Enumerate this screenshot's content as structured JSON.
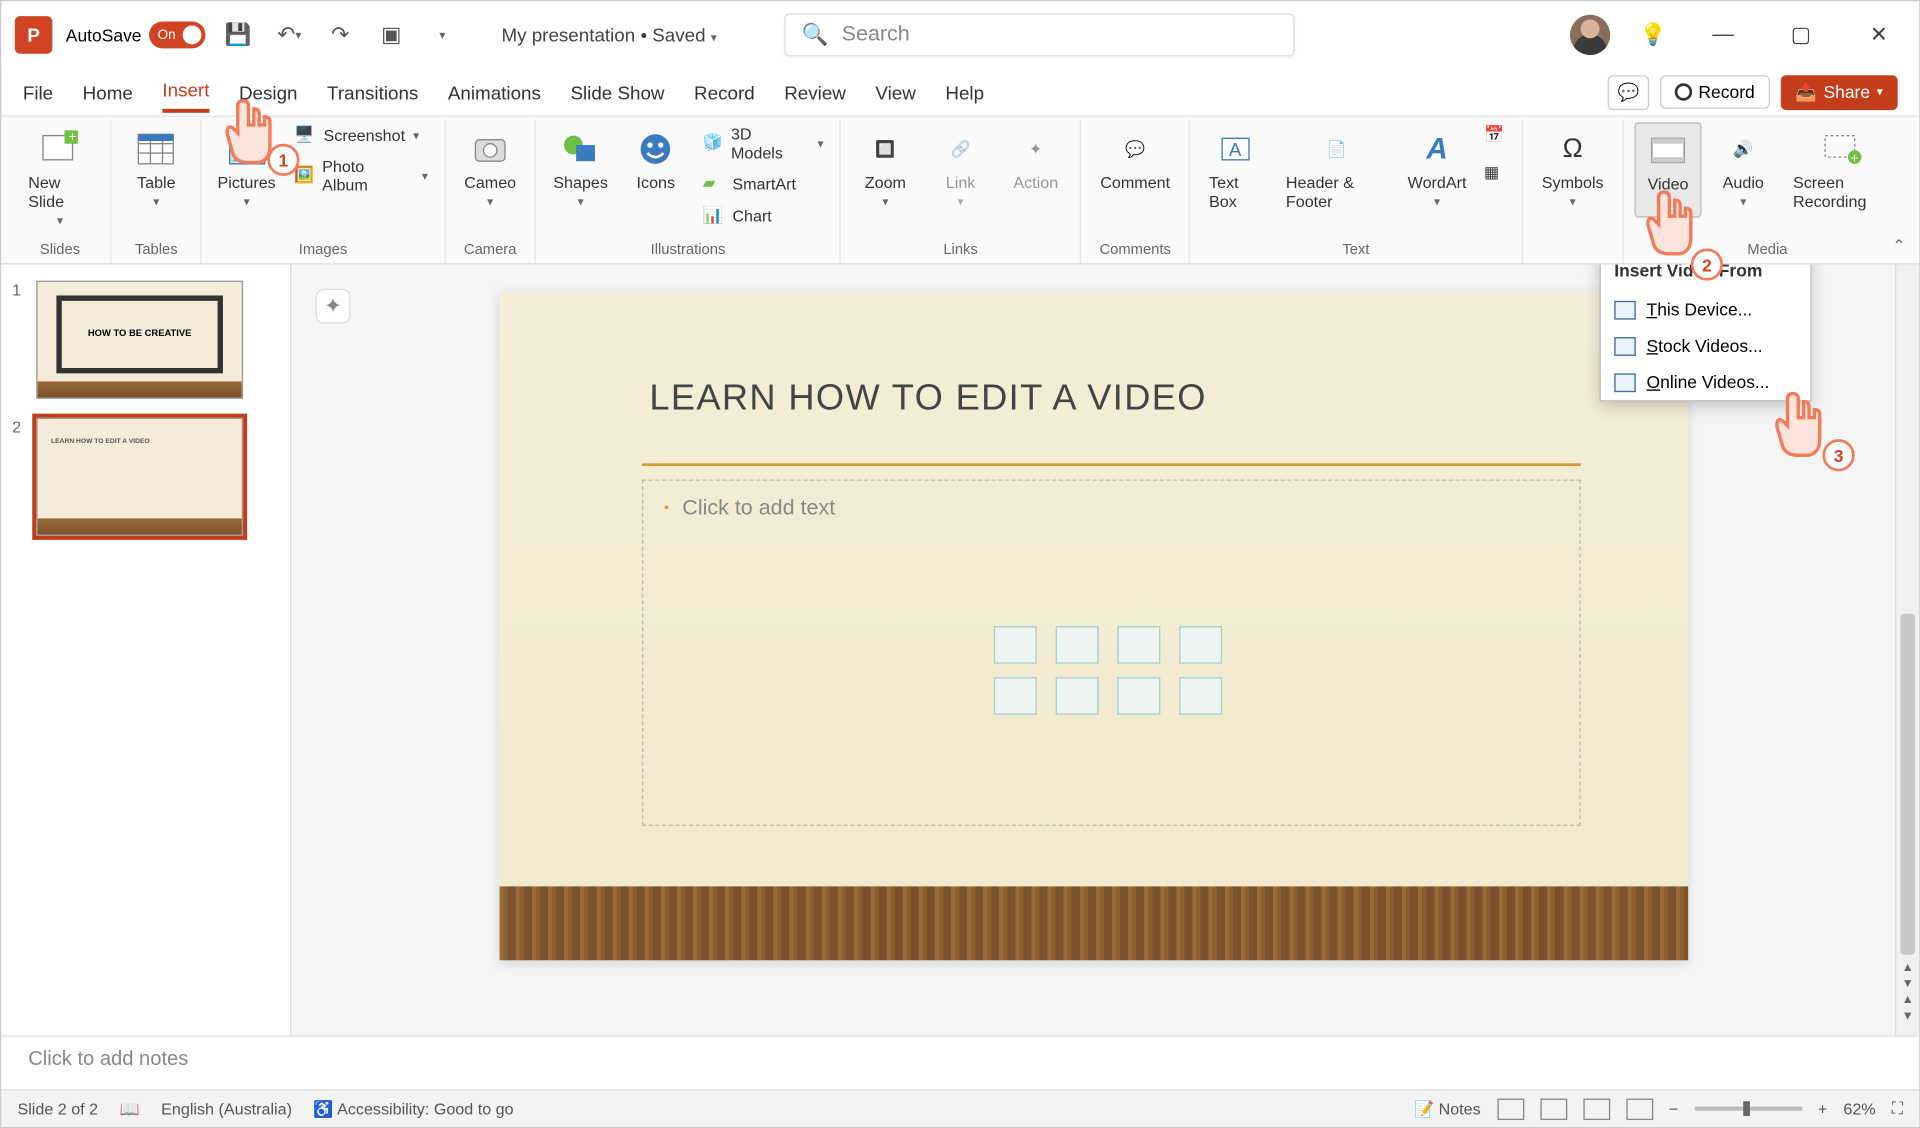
{
  "titlebar": {
    "autosave_label": "AutoSave",
    "autosave_state": "On",
    "doc_title": "My presentation • Saved",
    "search_placeholder": "Search"
  },
  "tabs": {
    "items": [
      "File",
      "Home",
      "Insert",
      "Design",
      "Transitions",
      "Animations",
      "Slide Show",
      "Record",
      "Review",
      "View",
      "Help"
    ],
    "active_index": 2,
    "record": "Record",
    "share": "Share"
  },
  "ribbon": {
    "new_slide": "New Slide",
    "table": "Table",
    "pictures": "Pictures",
    "screenshot": "Screenshot",
    "photo_album": "Photo Album",
    "cameo": "Cameo",
    "shapes": "Shapes",
    "icons": "Icons",
    "models3d": "3D Models",
    "smartart": "SmartArt",
    "chart": "Chart",
    "zoom": "Zoom",
    "link": "Link",
    "action": "Action",
    "comment": "Comment",
    "textbox": "Text Box",
    "header_footer": "Header & Footer",
    "wordart": "WordArt",
    "symbols": "Symbols",
    "video": "Video",
    "audio": "Audio",
    "screen_recording": "Screen Recording",
    "groups": {
      "slides": "Slides",
      "tables": "Tables",
      "images": "Images",
      "camera": "Camera",
      "illustrations": "Illustrations",
      "links": "Links",
      "comments": "Comments",
      "text": "Text",
      "media": "Media"
    }
  },
  "video_menu": {
    "header": "Insert Video From",
    "this_device": "This Device...",
    "stock": "Stock Videos...",
    "online": "Online Videos..."
  },
  "thumbs": {
    "slide1_title": "HOW TO BE CREATIVE",
    "slide2_title": "LEARN HOW TO EDIT A VIDEO"
  },
  "slide": {
    "title": "LEARN HOW TO EDIT A VIDEO",
    "placeholder": "Click to add text"
  },
  "notes": {
    "placeholder": "Click to add notes"
  },
  "status": {
    "slide_pos": "Slide 2 of 2",
    "language": "English (Australia)",
    "accessibility": "Accessibility: Good to go",
    "notes": "Notes",
    "zoom": "62%"
  },
  "annotations": {
    "n1": "1",
    "n2": "2",
    "n3": "3"
  }
}
